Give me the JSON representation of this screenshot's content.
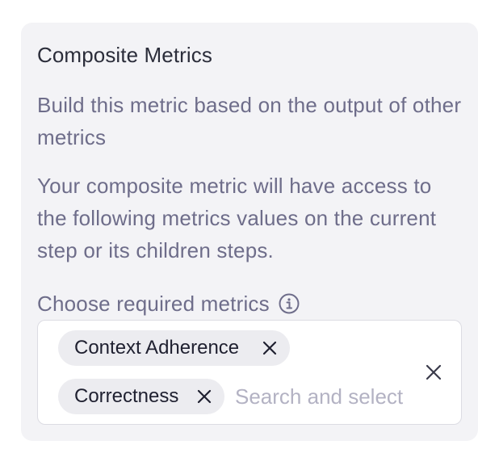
{
  "card": {
    "title": "Composite Metrics",
    "description": "Build this metric based on the output of other metrics",
    "info": "Your composite metric will have access to the following metrics values on the current step or its children steps."
  },
  "required_metrics": {
    "label": "Choose required metrics",
    "info_icon": "info-circle-icon",
    "selected": [
      {
        "label": "Context Adherence",
        "remove_icon": "close-icon"
      },
      {
        "label": "Correctness",
        "remove_icon": "close-icon"
      }
    ],
    "search_placeholder": "Search and select",
    "clear_icon": "close-icon"
  },
  "colors": {
    "card_bg": "#f3f3f6",
    "title": "#2b2d3a",
    "body_text": "#6e6d8a",
    "chip_bg": "#ececf0",
    "placeholder": "#b3b2c3"
  }
}
